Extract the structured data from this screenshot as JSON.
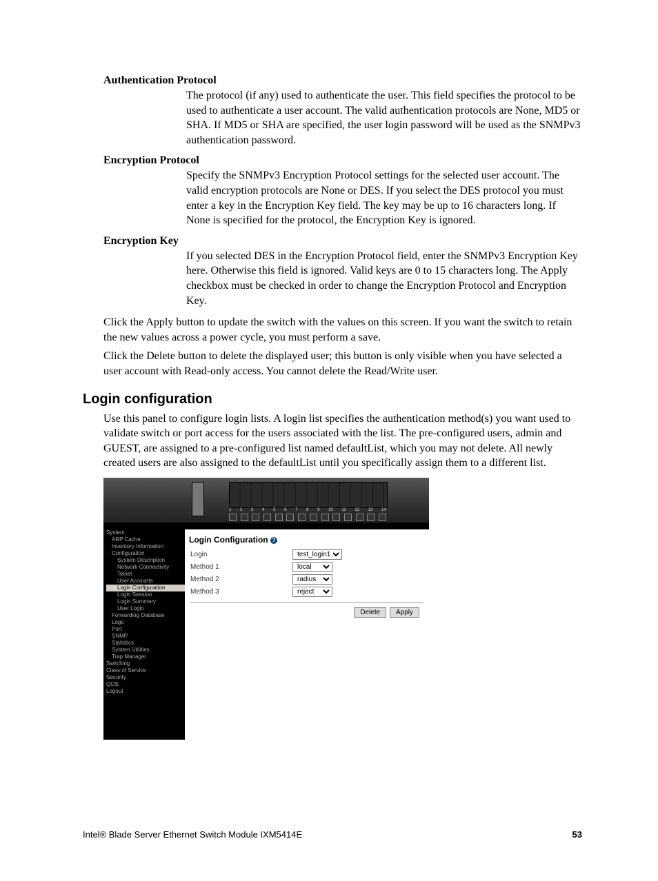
{
  "defs": {
    "d1": {
      "term": "Authentication Protocol",
      "text": "The protocol (if any) used to authenticate the user. This field specifies the protocol to be used to authenticate a user account. The valid authentication protocols are None, MD5 or SHA. If MD5 or SHA are specified, the user login password will be used as the SNMPv3 authentication password."
    },
    "d2": {
      "term": "Encryption Protocol",
      "text": "Specify the SNMPv3 Encryption Protocol settings for the selected user account. The valid encryption protocols are None or DES. If you select the DES protocol you must enter a key in the Encryption Key field. The key may be up to 16 characters long. If None is specified for the protocol, the Encryption Key is ignored."
    },
    "d3": {
      "term": "Encryption Key",
      "text": "If you selected DES in the Encryption Protocol field, enter the SNMPv3 Encryption Key here. Otherwise this field is ignored. Valid keys are 0 to 15 characters long. The Apply checkbox must be checked in order to change the Encryption Protocol and Encryption Key."
    }
  },
  "body": {
    "p1": "Click the Apply button to update the switch with the values on this screen. If you want the switch to retain the new values across a power cycle, you must perform a save.",
    "p2": "Click the Delete button to delete the displayed user; this button is only visible when you have selected a user account with Read-only access. You cannot delete the Read/Write user."
  },
  "section": {
    "heading": "Login configuration",
    "p1": "Use this panel to configure login lists. A login list specifies the authentication method(s) you want used to validate switch or port access for the users associated with the list. The pre-configured users, admin and GUEST, are assigned to a pre-configured list named defaultList, which you may not delete. All newly created users are also assigned to the defaultList until you specifically assign them to a different list."
  },
  "screenshot": {
    "ports": [
      "1",
      "2",
      "3",
      "4",
      "5",
      "6",
      "7",
      "8",
      "9",
      "10",
      "11",
      "12",
      "13",
      "14"
    ],
    "nav": {
      "system": "System",
      "arp": "ARP Cache",
      "inv": "Inventory Information",
      "cfg": "Configuration",
      "sd": "System Description",
      "nc": "Network Connectivity",
      "telnet": "Telnet",
      "ua": "User Accounts",
      "lc": "Login Configuration",
      "ls": "Login Session",
      "lsum": "Login Summary",
      "ul": "User Login",
      "fd": "Forwarding Database",
      "logs": "Logs",
      "port": "Port",
      "snmp": "SNMP",
      "stats": "Statistics",
      "sysu": "System Utilities",
      "trap": "Trap Manager",
      "sw": "Switching",
      "cos": "Class of Service",
      "sec": "Security",
      "qos": "QOS",
      "logout": "Logout"
    },
    "panel": {
      "title": "Login Configuration",
      "help": "?",
      "rows": {
        "login": "Login",
        "m1": "Method 1",
        "m2": "Method 2",
        "m3": "Method 3"
      },
      "values": {
        "login": "test_login1",
        "m1": "local",
        "m2": "radius",
        "m3": "reject"
      },
      "buttons": {
        "delete": "Delete",
        "apply": "Apply"
      }
    }
  },
  "footer": {
    "left": "Intel® Blade Server Ethernet Switch Module IXM5414E",
    "right": "53"
  }
}
